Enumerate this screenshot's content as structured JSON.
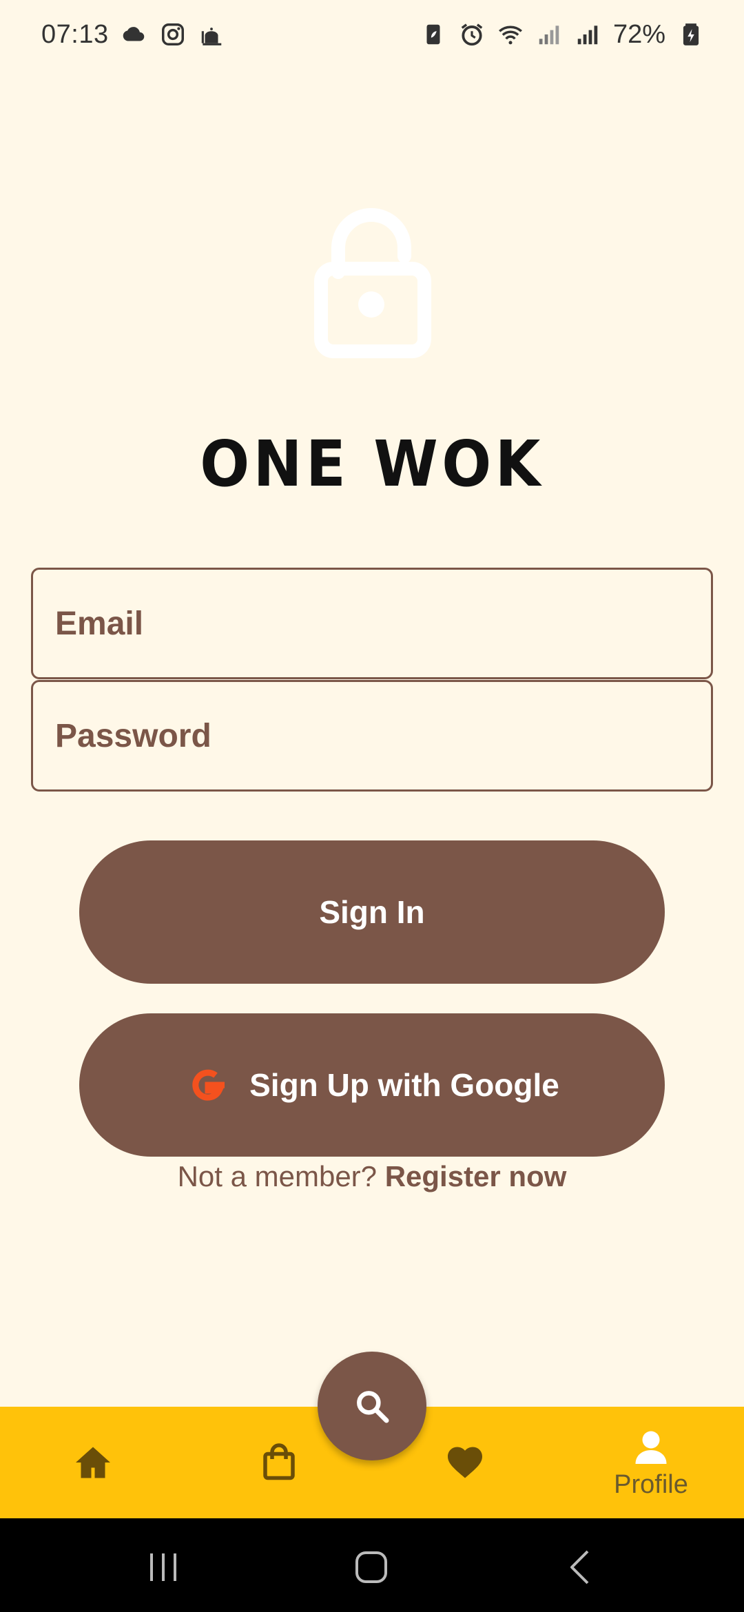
{
  "status_bar": {
    "time": "07:13",
    "battery": "72%",
    "left_icons": [
      "cloud-icon",
      "instagram-icon",
      "mosque-icon"
    ],
    "right_icons": [
      "battery-saver-icon",
      "alarm-icon",
      "wifi-icon",
      "signal-icon",
      "signal-icon",
      "battery-icon"
    ]
  },
  "brand": {
    "title": "ONE WOK",
    "illustration": "unlocked-padlock-icon"
  },
  "form": {
    "email_placeholder": "Email",
    "password_placeholder": "Password",
    "signin_label": "Sign In",
    "google_label": "Sign Up with Google",
    "register_prompt": "Not a member?",
    "register_link": "Register now"
  },
  "bottom_nav": {
    "items": [
      {
        "icon": "home-icon",
        "label": ""
      },
      {
        "icon": "shopping-bag-icon",
        "label": ""
      },
      {
        "icon": "heart-icon",
        "label": ""
      },
      {
        "icon": "person-icon",
        "label": "Profile"
      }
    ],
    "fab_icon": "search-icon",
    "active": "Profile"
  },
  "colors": {
    "background": "#FFF8E8",
    "primary": "#7B5648",
    "nav_bar": "#FFC20A",
    "google_accent": "#F4511E"
  }
}
